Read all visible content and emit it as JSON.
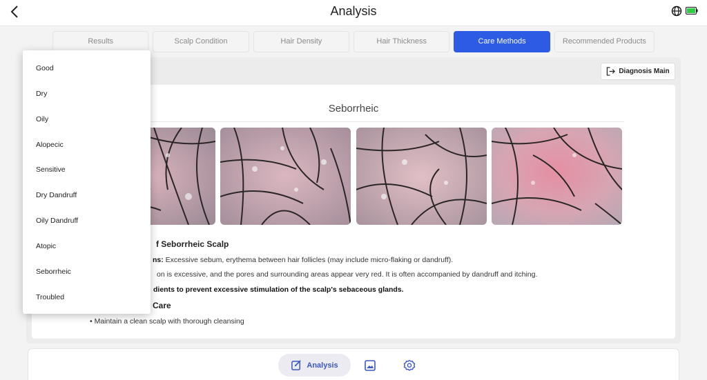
{
  "header": {
    "title": "Analysis"
  },
  "tabs": [
    {
      "label": "Results"
    },
    {
      "label": "Scalp Condition"
    },
    {
      "label": "Hair Density"
    },
    {
      "label": "Hair Thickness"
    },
    {
      "label": "Care Methods",
      "active": true
    },
    {
      "label": "Recommended Products"
    }
  ],
  "toolbar": {
    "diagnosis_main_label": "Diagnosis Main"
  },
  "content": {
    "condition_title": "Seborrheic",
    "section1_heading": "f Seborrheic Scalp",
    "line1_bold": "ns:",
    "line1_rest": " Excessive sebum, erythema between hair follicles (may include micro-flaking or dandruff).",
    "line2": "on is excessive, and the pores and surrounding areas appear very red. It is often accompanied by dandruff and itching.",
    "line3_bold": "dients to prevent excessive stimulation of the scalp's sebaceous glands.",
    "section2_heading": "Care",
    "bullet1": "•   Maintain a clean scalp with thorough cleansing"
  },
  "dropdown": {
    "items": [
      "Good",
      "Dry",
      "Oily",
      "Alopecic",
      "Sensitive",
      "Dry Dandruff",
      "Oily Dandruff",
      "Atopic",
      "Seborrheic",
      "Troubled"
    ]
  },
  "bottom_nav": {
    "analysis_label": "Analysis"
  },
  "colors": {
    "accent": "#2d5be3",
    "nav_active": "#3957c5",
    "battery": "#2ecc40"
  }
}
